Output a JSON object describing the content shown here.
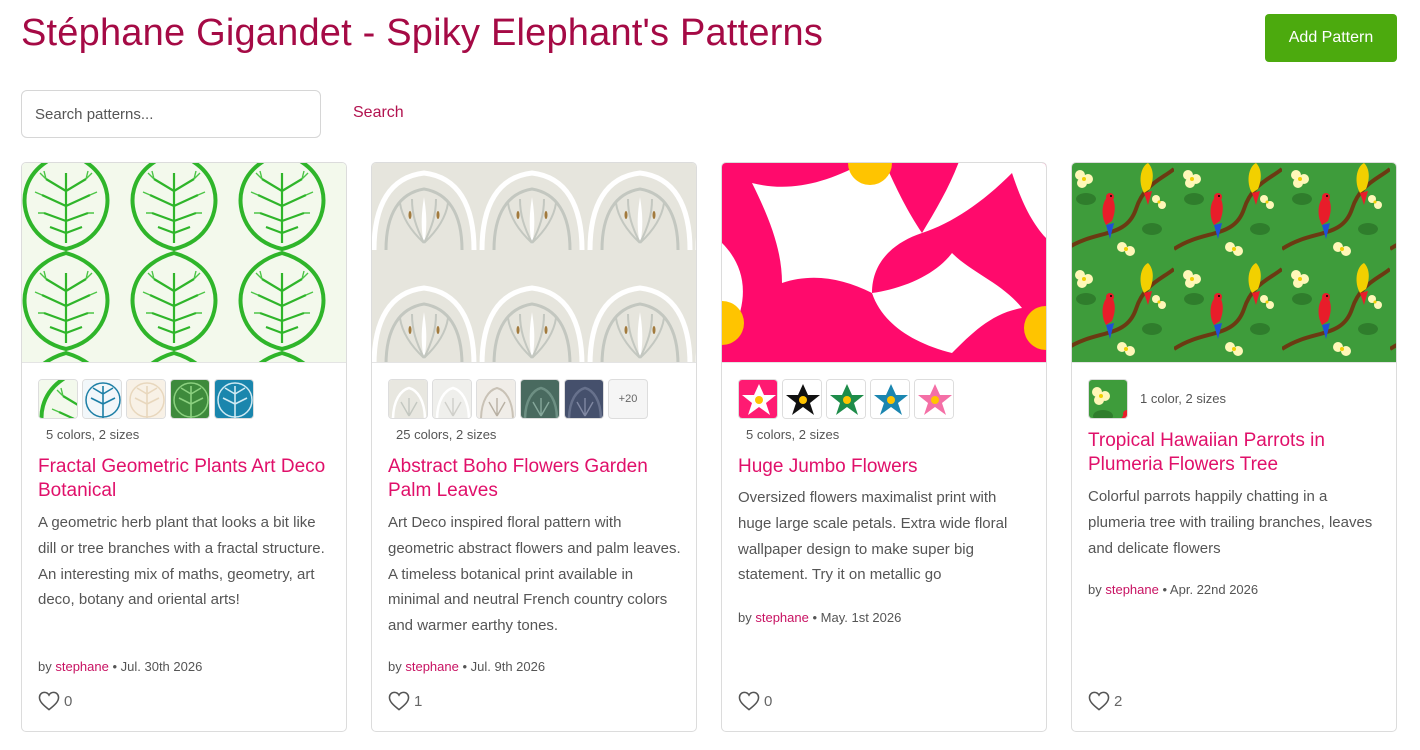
{
  "header": {
    "title": "Stéphane Gigandet - Spiky Elephant's Patterns",
    "add_button": "Add Pattern"
  },
  "search": {
    "placeholder": "Search patterns...",
    "button": "Search"
  },
  "colors": {
    "title": "#a50a45",
    "link": "#e0106a",
    "button": "#4caa0e"
  },
  "cards": [
    {
      "colors_text": "5 colors, 2 sizes",
      "title": "Fractal Geometric Plants Art Deco Botanical",
      "description": "A geometric herb plant that looks a bit like dill or tree branches with a fractal structure. An interesting mix of maths, geometry, art deco, botany and oriental arts!",
      "by": "by",
      "author": "stephane",
      "date": "• Jul. 30th 2026",
      "likes": "0"
    },
    {
      "colors_text": "25 colors, 2 sizes",
      "more": "+20",
      "title": "Abstract Boho Flowers Garden Palm Leaves",
      "description": "Art Deco inspired floral pattern with geometric abstract flowers and palm leaves. A timeless botanical print available in minimal and neutral French country colors and warmer earthy tones.",
      "by": "by",
      "author": "stephane",
      "date": "• Jul. 9th 2026",
      "likes": "1"
    },
    {
      "colors_text": "5 colors, 2 sizes",
      "title": "Huge Jumbo Flowers",
      "description": "Oversized flowers maximalist print with huge large scale petals. Extra wide floral wallpaper design to make super big statement. Try it on metallic go",
      "by": "by",
      "author": "stephane",
      "date": "• May. 1st 2026",
      "likes": "0"
    },
    {
      "colors_text": "1 color, 2 sizes",
      "title": "Tropical Hawaiian Parrots in Plumeria Flowers Tree",
      "description": "Colorful parrots happily chatting in a plumeria tree with trailing branches, leaves and delicate flowers",
      "by": "by",
      "author": "stephane",
      "date": "• Apr. 22nd 2026",
      "likes": "2"
    }
  ]
}
